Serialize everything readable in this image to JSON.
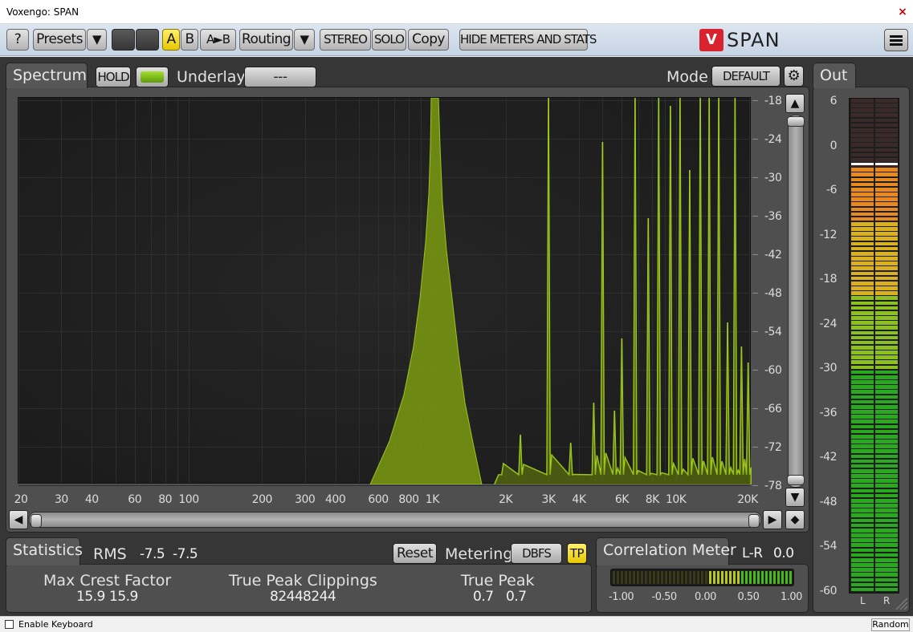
{
  "window": {
    "title": "Voxengo: SPAN",
    "close_glyph": "×"
  },
  "toolbar": {
    "help": "?",
    "presets": "Presets",
    "dropdown_glyph": "▼",
    "a": "A",
    "b": "B",
    "a_to_b": "A►B",
    "routing": "Routing",
    "stereo": "STEREO",
    "solo": "SOLO",
    "copy": "Copy",
    "hide_meters": "HIDE METERS AND STATS",
    "logo_mark": "V",
    "logo_text": "SPAN"
  },
  "spectrum": {
    "tab": "Spectrum",
    "hold": "HOLD",
    "underlay_label": "Underlay",
    "underlay_value": "---",
    "mode_label": "Mode",
    "mode_value": "DEFAULT",
    "db_ticks": [
      "-18",
      "-24",
      "-30",
      "-36",
      "-42",
      "-48",
      "-54",
      "-60",
      "-66",
      "-72",
      "-78"
    ],
    "freq_ticks": [
      "20",
      "30",
      "40",
      "60",
      "80",
      "100",
      "200",
      "300",
      "400",
      "600",
      "800",
      "1K",
      "2K",
      "3K",
      "4K",
      "6K",
      "8K",
      "10K",
      "20K"
    ]
  },
  "out_meter": {
    "tab": "Out",
    "ticks": [
      "6",
      "0",
      "-6",
      "-12",
      "-18",
      "-24",
      "-30",
      "-36",
      "-42",
      "-48",
      "-54",
      "-60"
    ],
    "channels": [
      "L",
      "R"
    ],
    "level_db": -3
  },
  "statistics": {
    "tab": "Statistics",
    "rms_label": "RMS",
    "rms_l": "-7.5",
    "rms_r": "-7.5",
    "reset": "Reset",
    "metering_label": "Metering",
    "metering_value": "DBFS",
    "tp": "TP",
    "crest_label": "Max Crest Factor",
    "crest_l": "15.9",
    "crest_r": "15.9",
    "clip_label": "True Peak Clippings",
    "clip_l": "8244",
    "clip_r": "8244",
    "tpeak_label": "True Peak",
    "tpeak_l": "0.7",
    "tpeak_r": "0.7"
  },
  "correlation": {
    "tab": "Correlation Meter",
    "mode": "L-R",
    "value": "0.0",
    "scale": [
      "-1.00",
      "-0.50",
      "0.00",
      "0.50",
      "1.00"
    ]
  },
  "status": {
    "enable_keyboard": "Enable Keyboard",
    "random": "Random"
  },
  "colors": {
    "accent_green": "#8fcf1f",
    "spectrum_fill": "#7a9a10",
    "yellow": "#f0d000"
  }
}
